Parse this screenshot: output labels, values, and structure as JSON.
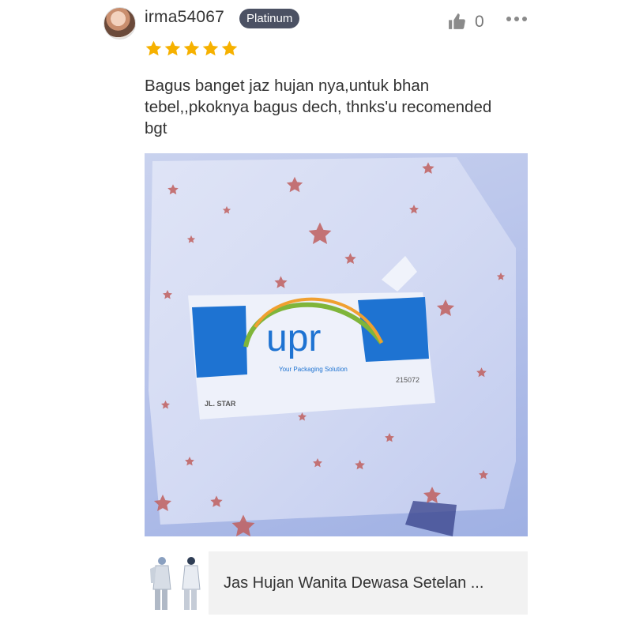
{
  "reviewer": {
    "username": "irma54067",
    "badge": "Platinum",
    "rating": 5
  },
  "actions": {
    "like_count": "0",
    "like_icon": "thumbs-up-icon",
    "more_icon": "more-dots-icon"
  },
  "review": {
    "text": "Bagus banget jaz hujan nya,untuk bhan\ntebel,,pkoknya bagus dech, thnks'u recomended\nbgt"
  },
  "photo": {
    "package_brand": "upr",
    "package_tagline": "Your Packaging Solution",
    "package_code": "215072",
    "package_label": "JL. STAR"
  },
  "product": {
    "title": "Jas Hujan Wanita Dewasa Setelan ..."
  },
  "colors": {
    "badge_bg": "#4b5163",
    "star": "#f6b100",
    "upr_blue": "#1e73d2",
    "upr_green": "#7fb53a",
    "upr_orange": "#f0a030"
  }
}
